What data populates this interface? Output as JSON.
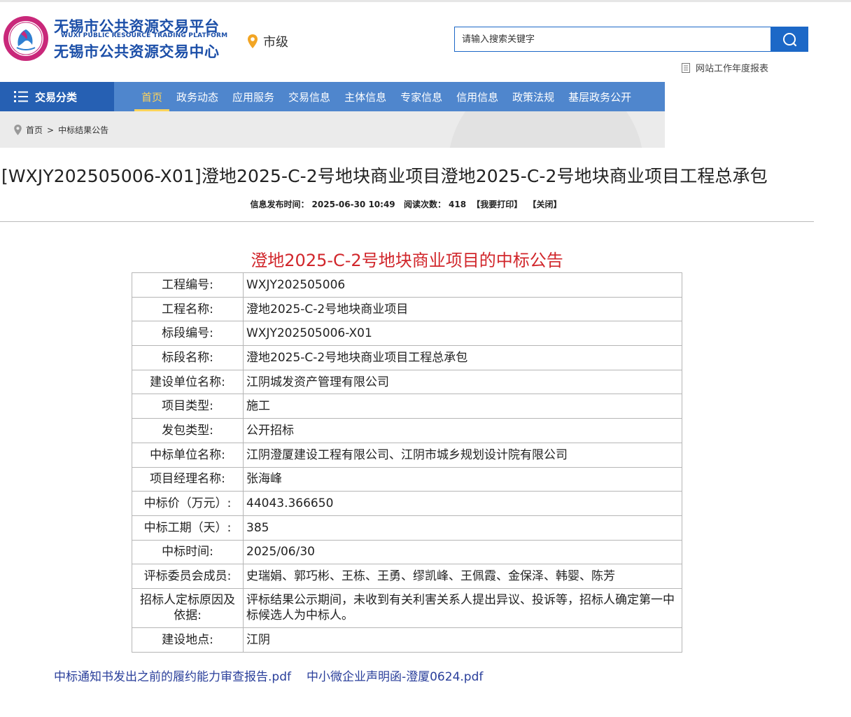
{
  "header": {
    "brand_line1": "无锡市公共资源交易平台",
    "brand_en": "WUXI PUBLIC RESOURCE TRADING PLATFORM",
    "brand_line2": "无锡市公共资源交易中心",
    "city": "市级",
    "search_placeholder": "请输入搜索关键字",
    "report_link": "网站工作年度报表"
  },
  "nav": {
    "category_label": "交易分类",
    "items": [
      {
        "label": "首页",
        "active": true
      },
      {
        "label": "政务动态"
      },
      {
        "label": "应用服务"
      },
      {
        "label": "交易信息"
      },
      {
        "label": "主体信息"
      },
      {
        "label": "专家信息"
      },
      {
        "label": "信用信息"
      },
      {
        "label": "政策法规"
      },
      {
        "label": "基层政务公开"
      }
    ]
  },
  "breadcrumb": {
    "home": "首页",
    "sep": ">",
    "current": "中标结果公告"
  },
  "article": {
    "title": "[WXJY202505006-X01]澄地2025-C-2号地块商业项目澄地2025-C-2号地块商业项目工程总承包",
    "meta": {
      "published_label": "信息发布时间：",
      "published": "2025-06-30 10:49",
      "views_label": "阅读次数：",
      "views": "418",
      "print": "【我要打印】",
      "close": "【关闭】"
    },
    "doc_title": "澄地2025-C-2号地块商业项目的中标公告",
    "rows": [
      {
        "k": "工程编号:",
        "v": "WXJY202505006"
      },
      {
        "k": "工程名称:",
        "v": "澄地2025-C-2号地块商业项目"
      },
      {
        "k": "标段编号:",
        "v": "WXJY202505006-X01"
      },
      {
        "k": "标段名称:",
        "v": "澄地2025-C-2号地块商业项目工程总承包"
      },
      {
        "k": "建设单位名称:",
        "v": "江阴城发资产管理有限公司"
      },
      {
        "k": "项目类型:",
        "v": "施工"
      },
      {
        "k": "发包类型:",
        "v": "公开招标"
      },
      {
        "k": "中标单位名称:",
        "v": "江阴澄厦建设工程有限公司、江阴市城乡规划设计院有限公司"
      },
      {
        "k": "项目经理名称:",
        "v": "张海峰"
      },
      {
        "k": "中标价（万元）:",
        "v": "44043.366650"
      },
      {
        "k": "中标工期（天）:",
        "v": "385"
      },
      {
        "k": "中标时间:",
        "v": "2025/06/30"
      },
      {
        "k": "评标委员会成员:",
        "v": "史瑞娟、郭巧彬、王栋、王勇、缪凯峰、王佩霞、金保泽、韩婴、陈芳"
      },
      {
        "k": "招标人定标原因及依据:",
        "v": "评标结果公示期间，未收到有关利害关系人提出异议、投诉等，招标人确定第一中标候选人为中标人。"
      },
      {
        "k": "建设地点:",
        "v": "江阴"
      }
    ],
    "attachments": [
      "中标通知书发出之前的履约能力审查报告.pdf",
      "中小微企业声明函-澄厦0624.pdf"
    ]
  },
  "colors": {
    "brand_blue": "#1c4fa8",
    "nav_blue": "#4f86cd",
    "nav_dark": "#2660b3",
    "active_yellow": "#ffd45a",
    "doc_title_red": "#d1262b",
    "link_blue": "#2a3f9b"
  },
  "icons": {
    "logo": "emblem-logo",
    "city": "location-pin-icon",
    "search": "search-icon",
    "report": "document-icon",
    "menu": "menu-list-icon",
    "crumb": "location-pin-icon"
  }
}
